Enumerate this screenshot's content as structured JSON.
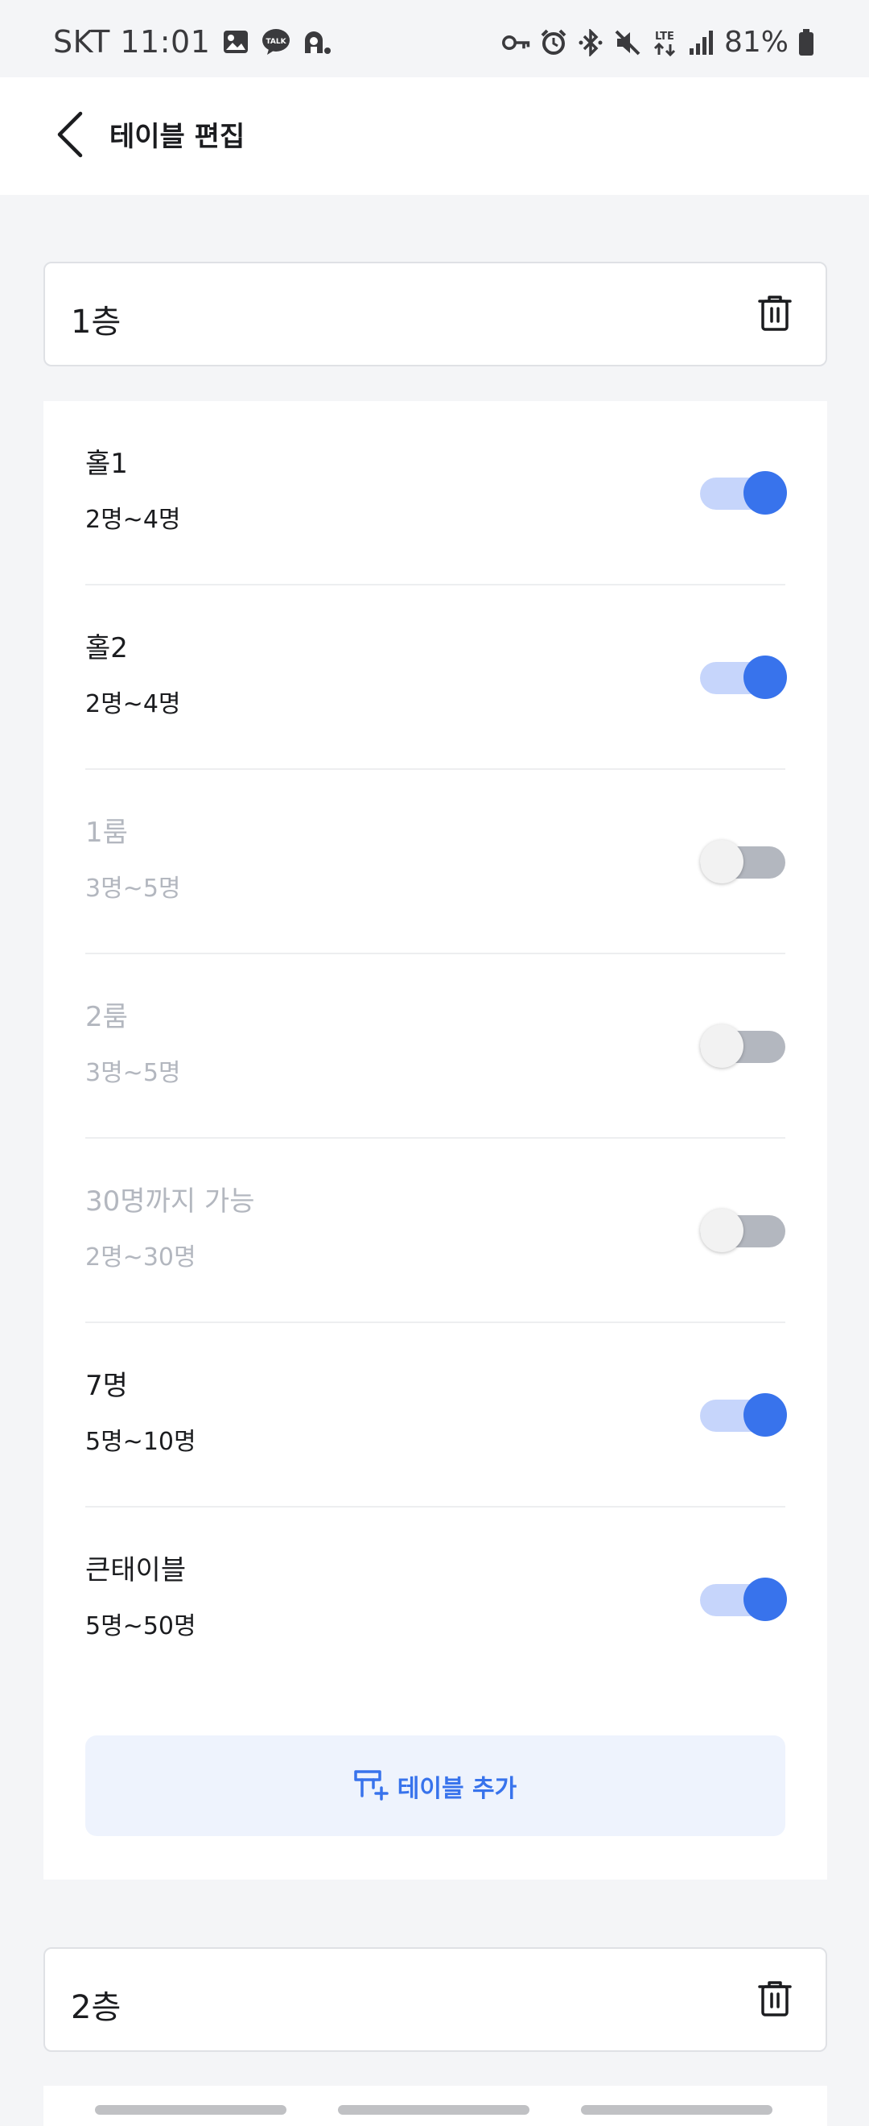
{
  "status_bar": {
    "time": "SKT 11:01",
    "battery": "81%",
    "left_icons": [
      "image-icon",
      "kakaotalk-icon",
      "notification-icon"
    ],
    "right_icons": [
      "vpn-key-icon",
      "alarm-icon",
      "bluetooth-icon",
      "mute-icon",
      "lte-icon",
      "signal-icon",
      "battery-icon"
    ]
  },
  "header": {
    "title": "테이블 편집",
    "back_icon": "chevron-left-icon"
  },
  "floors": [
    {
      "name": "1층",
      "delete_icon": "trash-icon",
      "tables": [
        {
          "name": "홀1",
          "range": "2명~4명",
          "enabled": true
        },
        {
          "name": "홀2",
          "range": "2명~4명",
          "enabled": true
        },
        {
          "name": "1룸",
          "range": "3명~5명",
          "enabled": false
        },
        {
          "name": "2룸",
          "range": "3명~5명",
          "enabled": false
        },
        {
          "name": "30명까지 가능",
          "range": "2명~30명",
          "enabled": false
        },
        {
          "name": "7명",
          "range": "5명~10명",
          "enabled": true
        },
        {
          "name": "큰태이블",
          "range": "5명~50명",
          "enabled": true
        }
      ],
      "add_button": {
        "label": "테이블 추가",
        "icon": "add-table-icon"
      }
    },
    {
      "name": "2층",
      "delete_icon": "trash-icon"
    }
  ],
  "colors": {
    "accent": "#3873ec",
    "accent_light": "#c6d5fb",
    "add_button_bg": "#eef3fd",
    "disabled_text": "#b3b7bf",
    "page_bg": "#f4f5f7"
  }
}
